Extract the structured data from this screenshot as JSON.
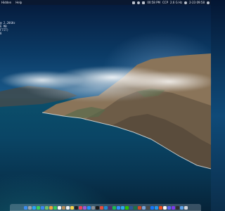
{
  "menubar": {
    "app_name": "Hidden",
    "menus": [
      "Help"
    ],
    "status_items": [
      {
        "icon": "cpu-meter-icon"
      },
      {
        "icon": "network-icon"
      },
      {
        "icon": "wifi-icon"
      }
    ],
    "clock_left": "00:58 PM",
    "stats_label": "CCP",
    "cpu_text": "2.6 G Hz",
    "date_time": "2-23 09:58",
    "right_icons": [
      "control-center-icon",
      "siri-icon"
    ]
  },
  "desktop_widget": {
    "lines": [
      "",
      "@ 2.20GHz",
      "",
      "6 MB",
      "F7IT)",
      "",
      "",
      "",
      "",
      "8"
    ]
  },
  "wallpaper": {
    "description_color_sky": "#0b3b66",
    "color_sea": "#0a4565",
    "color_cliffs": "#7a6a55"
  },
  "dock": {
    "icons": [
      {
        "name": "finder-icon",
        "color": "#3b8df0"
      },
      {
        "name": "launchpad-icon",
        "color": "#9aa3ae"
      },
      {
        "name": "safari-icon",
        "color": "#2aa3f5"
      },
      {
        "name": "messages-icon",
        "color": "#3bcf59"
      },
      {
        "name": "mail-icon",
        "color": "#3a86f1"
      },
      {
        "name": "maps-icon",
        "color": "#6fc16a"
      },
      {
        "name": "photos-icon",
        "color": "#f2a23b"
      },
      {
        "name": "facetime-icon",
        "color": "#34c759"
      },
      {
        "name": "calendar-icon",
        "color": "#f5f5f5"
      },
      {
        "name": "contacts-icon",
        "color": "#b48b5a"
      },
      {
        "name": "reminders-icon",
        "color": "#f0f0f0"
      },
      {
        "name": "notes-icon",
        "color": "#f5d34b"
      },
      {
        "name": "tv-icon",
        "color": "#202124"
      },
      {
        "name": "music-icon",
        "color": "#f1425a"
      },
      {
        "name": "podcasts-icon",
        "color": "#9b59d6"
      },
      {
        "name": "app-store-icon",
        "color": "#1e90ff"
      },
      {
        "name": "system-preferences-icon",
        "color": "#8a8f98"
      },
      {
        "name": "terminal-icon",
        "color": "#1b1b1b"
      },
      {
        "name": "chrome-icon",
        "color": "#e74c3c"
      },
      {
        "name": "vscode-icon",
        "color": "#1f8ad2"
      },
      {
        "name": "slack-icon",
        "color": "#5b2c6f"
      },
      {
        "name": "spotify-icon",
        "color": "#1db954"
      },
      {
        "name": "zoom-icon",
        "color": "#2d8cff"
      },
      {
        "name": "telegram-icon",
        "color": "#2aabee"
      },
      {
        "name": "wechat-icon",
        "color": "#2dc100"
      },
      {
        "name": "word-icon",
        "color": "#2b5797"
      },
      {
        "name": "excel-icon",
        "color": "#1e7145"
      },
      {
        "name": "powerpoint-icon",
        "color": "#d24726"
      },
      {
        "name": "preview-icon",
        "color": "#7aa2d6"
      },
      {
        "name": "activity-monitor-icon",
        "color": "#4a4a4a"
      },
      {
        "name": "xcode-icon",
        "color": "#1575f9"
      },
      {
        "name": "docker-icon",
        "color": "#2496ed"
      },
      {
        "name": "figma-icon",
        "color": "#f24e1e"
      },
      {
        "name": "notion-icon",
        "color": "#f7f7f7"
      },
      {
        "name": "discord-icon",
        "color": "#5865f2"
      },
      {
        "name": "obsidian-icon",
        "color": "#7c3aed"
      },
      {
        "name": "iterm-icon",
        "color": "#2f2f2f"
      },
      {
        "name": "downloads-folder-icon",
        "color": "#5aa0e8"
      },
      {
        "name": "trash-icon",
        "color": "#cfd4db"
      }
    ]
  }
}
